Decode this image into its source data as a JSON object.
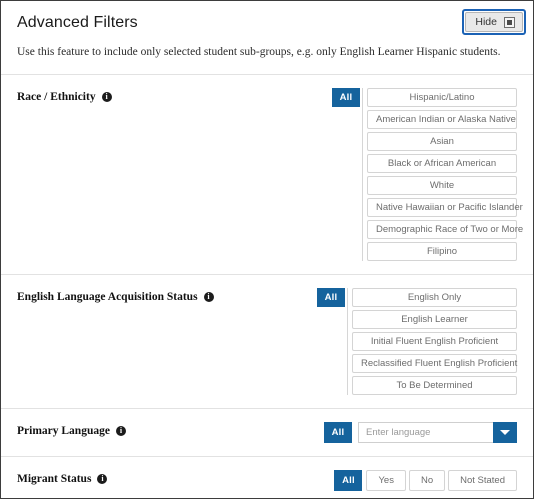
{
  "panel": {
    "title": "Advanced Filters",
    "description": "Use this feature to include only selected student sub-groups, e.g. only English Learner Hispanic students.",
    "hide_button": {
      "label": "Hide",
      "icon": "collapse-square-icon"
    }
  },
  "colors": {
    "accent_blue": "#15639d",
    "focus_ring": "#1b62b5",
    "border": "#d4d4d4",
    "divider": "#e2e2e2",
    "option_text": "#6d6d6d"
  },
  "sections": [
    {
      "key": "race_ethnicity",
      "label": "Race / Ethnicity",
      "info_icon": "info-icon",
      "all_label": "All",
      "all_selected": true,
      "options": [
        "Hispanic/Latino",
        "American Indian or Alaska Native",
        "Asian",
        "Black or African American",
        "White",
        "Native Hawaiian or Pacific Islander",
        "Demographic Race of Two or More",
        "Filipino"
      ]
    },
    {
      "key": "english_language_acquisition_status",
      "label": "English Language Acquisition Status",
      "info_icon": "info-icon",
      "all_label": "All",
      "all_selected": true,
      "options": [
        "English Only",
        "English Learner",
        "Initial Fluent English Proficient",
        "Reclassified Fluent English Proficient",
        "To Be Determined"
      ]
    },
    {
      "key": "primary_language",
      "label": "Primary Language",
      "info_icon": "info-icon",
      "all_label": "All",
      "all_selected": true,
      "input_value": "",
      "input_placeholder": "Enter language",
      "dropdown_icon": "chevron-down-icon"
    },
    {
      "key": "migrant_status",
      "label": "Migrant Status",
      "info_icon": "info-icon",
      "all_label": "All",
      "all_selected": true,
      "options": [
        "Yes",
        "No",
        "Not Stated"
      ]
    }
  ],
  "info_glyph": "i"
}
